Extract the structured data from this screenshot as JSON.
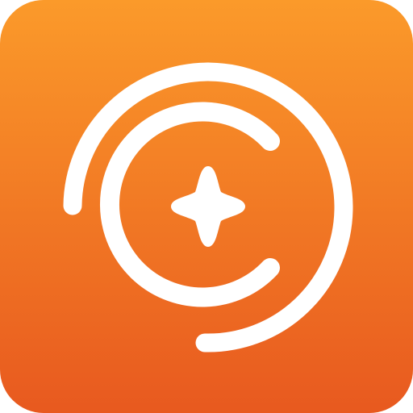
{
  "app_icon": {
    "icon_name": "orbit-sparkle-app-icon",
    "colors": {
      "gradient_top": "#FB9A2A",
      "gradient_bottom": "#E8591F",
      "glyph": "#FFFFFF"
    }
  }
}
